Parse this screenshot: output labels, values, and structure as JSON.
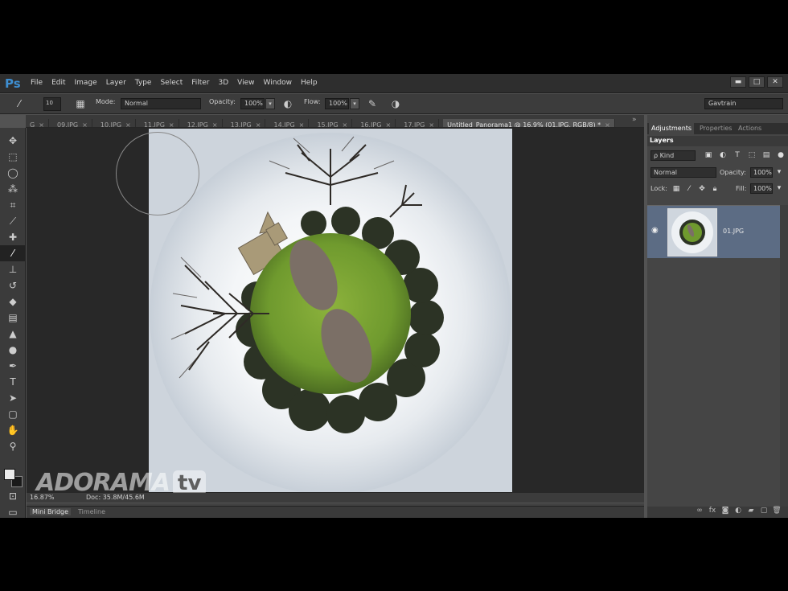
{
  "app": {
    "logo": "Ps"
  },
  "menu": [
    "File",
    "Edit",
    "Image",
    "Layer",
    "Type",
    "Select",
    "Filter",
    "3D",
    "View",
    "Window",
    "Help"
  ],
  "window_controls": [
    "▬",
    "□",
    "✕"
  ],
  "options": {
    "brush_size": "10",
    "mode_label": "Mode:",
    "mode_value": "Normal",
    "opacity_label": "Opacity:",
    "opacity_value": "100%",
    "flow_label": "Flow:",
    "flow_value": "100%",
    "workspace": "Gavtrain"
  },
  "tabs": [
    {
      "label": "G",
      "close": "×"
    },
    {
      "label": "09.JPG",
      "close": "×"
    },
    {
      "label": "10.JPG",
      "close": "×"
    },
    {
      "label": "11.JPG",
      "close": "×"
    },
    {
      "label": "12.JPG",
      "close": "×"
    },
    {
      "label": "13.JPG",
      "close": "×"
    },
    {
      "label": "14.JPG",
      "close": "×"
    },
    {
      "label": "15.JPG",
      "close": "×"
    },
    {
      "label": "16.JPG",
      "close": "×"
    },
    {
      "label": "17.JPG",
      "close": "×"
    }
  ],
  "active_tab": {
    "label": "Untitled_Panorama1 @ 16.9% (01.JPG, RGB/8) *",
    "close": "×"
  },
  "tab_overflow": "»",
  "status": {
    "zoom": "16.87%",
    "doc": "Doc: 35.8M/45.6M"
  },
  "bottom_tabs": [
    "Mini Bridge",
    "Timeline"
  ],
  "watermark": {
    "brand": "ADORAMA",
    "tv": "tv"
  },
  "panels": {
    "top_tabs": [
      "Adjustments",
      "Properties",
      "Actions"
    ],
    "layers_tab": "Layers",
    "filter_kind": "ρ Kind",
    "blend_mode": "Normal",
    "opacity_label": "Opacity:",
    "opacity_value": "100%",
    "lock_label": "Lock:",
    "fill_label": "Fill:",
    "fill_value": "100%",
    "layer_name": "01.JPG"
  },
  "colors": {
    "accent": "#3e8ed0",
    "selected_layer": "#5c6c84",
    "grass": "#6f9a2e",
    "sky": "#cdd4dc"
  },
  "icons": [
    "move-icon",
    "marquee-icon",
    "lasso-icon",
    "quick-select-icon",
    "crop-icon",
    "eyedropper-icon",
    "healing-icon",
    "brush-icon",
    "clone-stamp-icon",
    "history-brush-icon",
    "eraser-icon",
    "gradient-icon",
    "blur-icon",
    "dodge-icon",
    "pen-icon",
    "type-icon",
    "path-select-icon",
    "shape-icon",
    "hand-icon",
    "zoom-icon"
  ]
}
